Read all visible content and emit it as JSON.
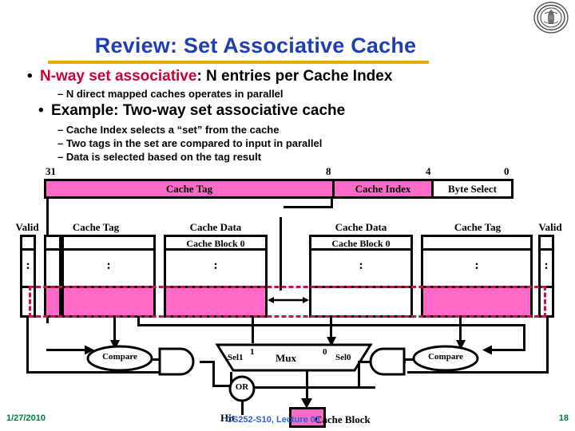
{
  "slide": {
    "title": "Review: Set Associative Cache",
    "title_color": "#1f3fb0",
    "rule_color": "#e8a800",
    "highlight_color": "#cc0033",
    "pink": "#ff69c8",
    "dash_color": "#cc1144"
  },
  "logo": {
    "name": "uc-berkeley-seal"
  },
  "bullets": {
    "b1_dot": "•",
    "b1_strong": "N-way set associative",
    "b1_rest": ": N entries per Cache Index",
    "b1_sub_dash": "–",
    "b1_sub": "N direct mapped caches operates in parallel",
    "b2_dot": "•",
    "b2": "Example: Two-way set associative cache",
    "b2_sub1": "Cache Index selects a “set” from the cache",
    "b2_sub2": "Two tags in the set are compared to input in parallel",
    "b2_sub3": "Data is selected based on the tag result",
    "dash": "–"
  },
  "address": {
    "bit_31": "31",
    "bit_8": "8",
    "bit_4": "4",
    "bit_0": "0",
    "seg_tag": "Cache Tag",
    "seg_index": "Cache Index",
    "seg_byte": "Byte Select"
  },
  "columns": {
    "valid_left": "Valid",
    "tag_left": "Cache Tag",
    "data_left": "Cache Data",
    "data_right": "Cache Data",
    "tag_right": "Cache Tag",
    "valid_right": "Valid"
  },
  "cells": {
    "block_left": "Cache Block 0",
    "block_right": "Cache Block 0",
    "vdots": "⋮"
  },
  "logic": {
    "compare_left": "Compare",
    "compare_right": "Compare",
    "mux": "Mux",
    "sel1": "Sel1",
    "sel0": "Sel0",
    "one": "1",
    "zero": "0",
    "or": "OR",
    "hit": "Hit",
    "cache_block": "Cache Block"
  },
  "footer": {
    "date": "1/27/2010",
    "center": "CS252-S10, Lecture 03",
    "page": "18"
  }
}
